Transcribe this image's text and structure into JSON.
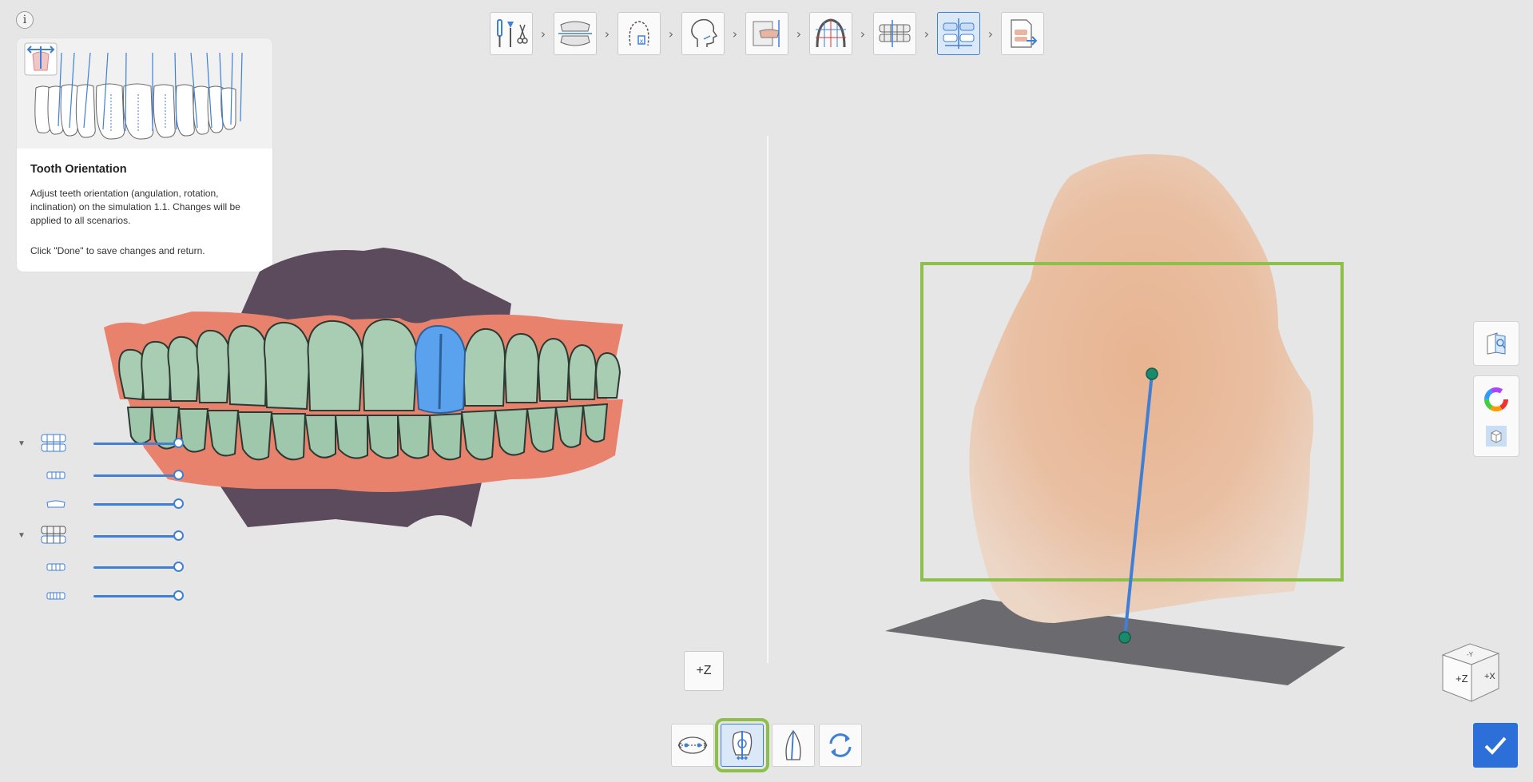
{
  "info": {
    "glyph": "i"
  },
  "steps": [
    {
      "id": "prepare",
      "icon": "tools-icon"
    },
    {
      "id": "scan-data",
      "icon": "jaw-scan-icon"
    },
    {
      "id": "tooth-setup",
      "icon": "tooth-chart-icon"
    },
    {
      "id": "face",
      "icon": "face-profile-icon"
    },
    {
      "id": "align",
      "icon": "align-icon"
    },
    {
      "id": "arch",
      "icon": "arch-grid-icon"
    },
    {
      "id": "occlusion",
      "icon": "occlusion-icon"
    },
    {
      "id": "tooth-orientation",
      "icon": "tooth-orientation-icon",
      "active": true
    },
    {
      "id": "export",
      "icon": "export-icon"
    }
  ],
  "guide": {
    "title": "Tooth Orientation",
    "body1": "Adjust teeth orientation (angulation, rotation, inclination) on the simulation 1.1. Changes will be applied to all scenarios.",
    "body2": "Click \"Done\" to save changes and return."
  },
  "layers": [
    {
      "name": "upper-jaw-group",
      "level": 1
    },
    {
      "name": "upper-scan",
      "level": 1
    },
    {
      "name": "upper-restoration",
      "level": 1
    },
    {
      "name": "lower-jaw-group",
      "level": 1
    },
    {
      "name": "lower-scan",
      "level": 1
    },
    {
      "name": "lower-restoration",
      "level": 1
    }
  ],
  "z_button": {
    "label": "+Z"
  },
  "view_cube": {
    "front": "+Z",
    "side": "+X",
    "top": "-Y"
  },
  "colors": {
    "accent": "#3f7fd6",
    "highlight": "#8cc04b",
    "gingiva": "#e9826d",
    "teeth": "#a9cdb2",
    "selected_tooth": "#5aa2ee",
    "tooth_skin": "#e7b99b"
  },
  "bottom_tools": [
    {
      "id": "move",
      "icon": "move-axis-icon"
    },
    {
      "id": "tooth-axis",
      "icon": "tooth-axis-icon",
      "active": true
    },
    {
      "id": "profile",
      "icon": "tooth-profile-icon"
    },
    {
      "id": "reset",
      "icon": "reset-rotation-icon"
    }
  ],
  "done": {
    "icon": "check-icon"
  }
}
